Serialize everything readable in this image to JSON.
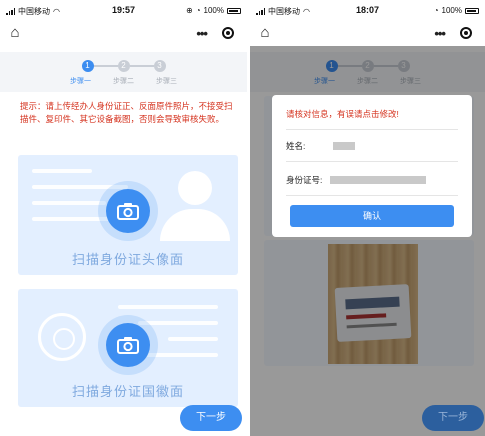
{
  "status_left": {
    "carrier": "中国移动",
    "time": "19:57",
    "battery": "100%"
  },
  "status_right": {
    "carrier": "中国移动",
    "time": "18:07",
    "battery": "100%"
  },
  "nav": {
    "home_icon": "home-icon",
    "more_label": "•••"
  },
  "steps": [
    {
      "number": "1",
      "label": "步骤一",
      "active": true
    },
    {
      "number": "2",
      "label": "步骤二",
      "active": false
    },
    {
      "number": "3",
      "label": "步骤三",
      "active": false
    }
  ],
  "notice": "提示：请上传经办人身份证正、反面原件照片，不接受扫描件、复印件、其它设备截图，否则会导致审核失败。",
  "cards": {
    "front_caption": "扫描身份证头像面",
    "back_caption": "扫描身份证国徽面"
  },
  "next_label": "下一步",
  "modal": {
    "title": "请核对信息，有误请点击修改!",
    "name_label": "姓名:",
    "id_label": "身份证号:",
    "confirm_label": "确认"
  },
  "colors": {
    "accent": "#3d8ef1",
    "warning": "#d5331f",
    "card_bg": "#e3efff"
  }
}
